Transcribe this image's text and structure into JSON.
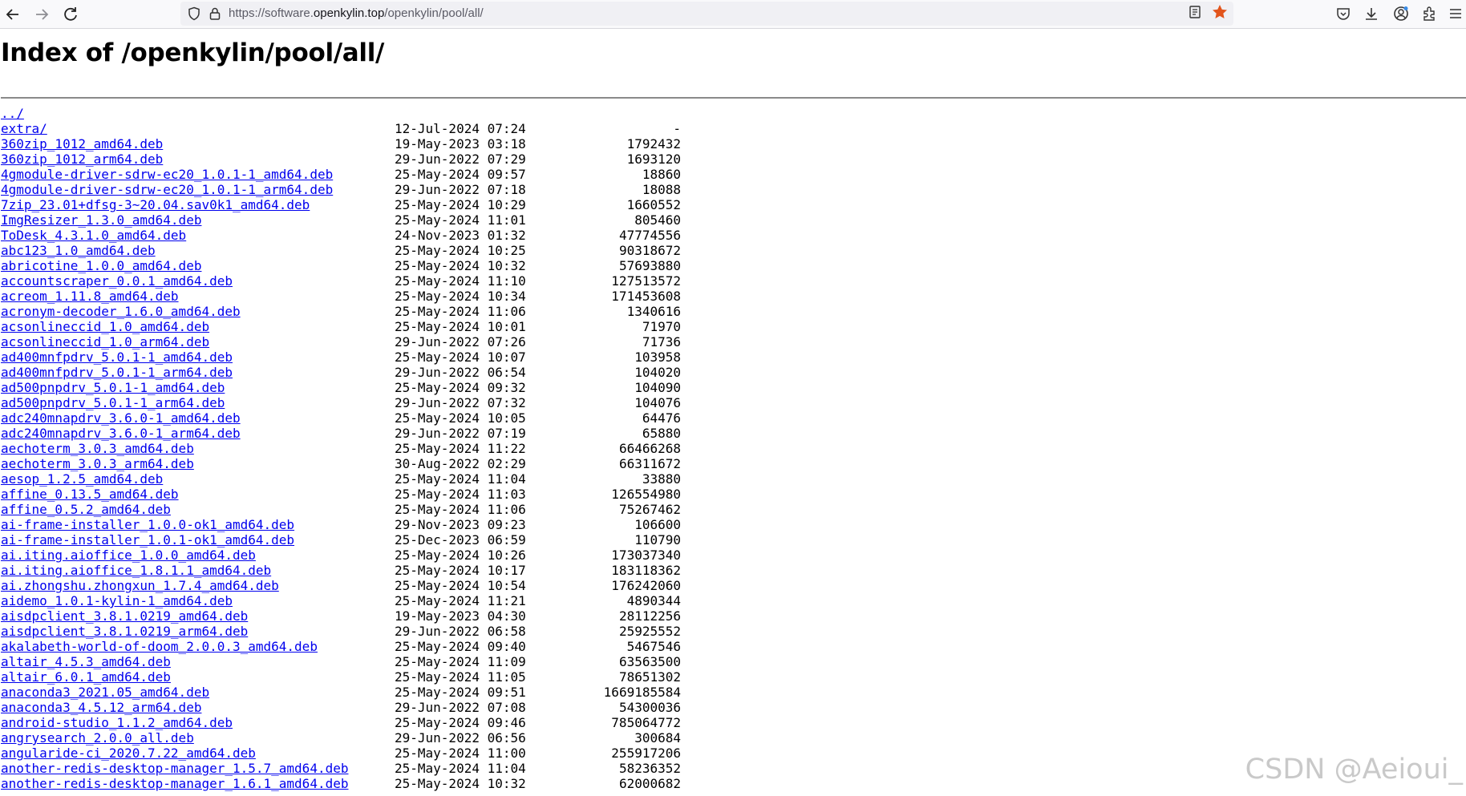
{
  "browser": {
    "url_prefix": "https://software.",
    "url_host": "openkylin.top",
    "url_path": "/openkylin/pool/all/",
    "icons": [
      "back-arrow-icon",
      "forward-arrow-icon",
      "reload-icon",
      "shield-icon",
      "lock-icon",
      "reader-view-icon",
      "bookmark-star-icon",
      "pocket-icon",
      "download-icon",
      "account-icon",
      "extensions-icon",
      "menu-icon"
    ],
    "star_color": "#e2541b"
  },
  "page": {
    "title": "Index of /openkylin/pool/all/",
    "watermark": "CSDN @Aeioui_",
    "link_color": "#0000ee"
  },
  "entries": [
    {
      "name": "../",
      "date": "",
      "size": ""
    },
    {
      "name": "extra/",
      "date": "12-Jul-2024 07:24",
      "size": "-"
    },
    {
      "name": "360zip_1012_amd64.deb",
      "date": "19-May-2023 03:18",
      "size": "1792432"
    },
    {
      "name": "360zip_1012_arm64.deb",
      "date": "29-Jun-2022 07:29",
      "size": "1693120"
    },
    {
      "name": "4gmodule-driver-sdrw-ec20_1.0.1-1_amd64.deb",
      "date": "25-May-2024 09:57",
      "size": "18860"
    },
    {
      "name": "4gmodule-driver-sdrw-ec20_1.0.1-1_arm64.deb",
      "date": "29-Jun-2022 07:18",
      "size": "18088"
    },
    {
      "name": "7zip_23.01+dfsg-3~20.04.sav0k1_amd64.deb",
      "date": "25-May-2024 10:29",
      "size": "1660552"
    },
    {
      "name": "ImgResizer_1.3.0_amd64.deb",
      "date": "25-May-2024 11:01",
      "size": "805460"
    },
    {
      "name": "ToDesk_4.3.1.0_amd64.deb",
      "date": "24-Nov-2023 01:32",
      "size": "47774556"
    },
    {
      "name": "abc123_1.0_amd64.deb",
      "date": "25-May-2024 10:25",
      "size": "90318672"
    },
    {
      "name": "abricotine_1.0.0_amd64.deb",
      "date": "25-May-2024 10:32",
      "size": "57693880"
    },
    {
      "name": "accountscraper_0.0.1_amd64.deb",
      "date": "25-May-2024 11:10",
      "size": "127513572"
    },
    {
      "name": "acreom_1.11.8_amd64.deb",
      "date": "25-May-2024 10:34",
      "size": "171453608"
    },
    {
      "name": "acronym-decoder_1.6.0_amd64.deb",
      "date": "25-May-2024 11:06",
      "size": "1340616"
    },
    {
      "name": "acsonlineccid_1.0_amd64.deb",
      "date": "25-May-2024 10:01",
      "size": "71970"
    },
    {
      "name": "acsonlineccid_1.0_arm64.deb",
      "date": "29-Jun-2022 07:26",
      "size": "71736"
    },
    {
      "name": "ad400mnfpdrv_5.0.1-1_amd64.deb",
      "date": "25-May-2024 10:07",
      "size": "103958"
    },
    {
      "name": "ad400mnfpdrv_5.0.1-1_arm64.deb",
      "date": "29-Jun-2022 06:54",
      "size": "104020"
    },
    {
      "name": "ad500pnpdrv_5.0.1-1_amd64.deb",
      "date": "25-May-2024 09:32",
      "size": "104090"
    },
    {
      "name": "ad500pnpdrv_5.0.1-1_arm64.deb",
      "date": "29-Jun-2022 07:32",
      "size": "104076"
    },
    {
      "name": "adc240mnapdrv_3.6.0-1_amd64.deb",
      "date": "25-May-2024 10:05",
      "size": "64476"
    },
    {
      "name": "adc240mnapdrv_3.6.0-1_arm64.deb",
      "date": "29-Jun-2022 07:19",
      "size": "65880"
    },
    {
      "name": "aechoterm_3.0.3_amd64.deb",
      "date": "25-May-2024 11:22",
      "size": "66466268"
    },
    {
      "name": "aechoterm_3.0.3_arm64.deb",
      "date": "30-Aug-2022 02:29",
      "size": "66311672"
    },
    {
      "name": "aesop_1.2.5_amd64.deb",
      "date": "25-May-2024 11:04",
      "size": "33880"
    },
    {
      "name": "affine_0.13.5_amd64.deb",
      "date": "25-May-2024 11:03",
      "size": "126554980"
    },
    {
      "name": "affine_0.5.2_amd64.deb",
      "date": "25-May-2024 11:06",
      "size": "75267462"
    },
    {
      "name": "ai-frame-installer_1.0.0-ok1_amd64.deb",
      "date": "29-Nov-2023 09:23",
      "size": "106600"
    },
    {
      "name": "ai-frame-installer_1.0.1-ok1_amd64.deb",
      "date": "25-Dec-2023 06:59",
      "size": "110790"
    },
    {
      "name": "ai.iting.aioffice_1.0.0_amd64.deb",
      "date": "25-May-2024 10:26",
      "size": "173037340"
    },
    {
      "name": "ai.iting.aioffice_1.8.1.1_amd64.deb",
      "date": "25-May-2024 10:17",
      "size": "183118362"
    },
    {
      "name": "ai.zhongshu.zhongxun_1.7.4_amd64.deb",
      "date": "25-May-2024 10:54",
      "size": "176242060"
    },
    {
      "name": "aidemo_1.0.1-kylin-1_amd64.deb",
      "date": "25-May-2024 11:21",
      "size": "4890344"
    },
    {
      "name": "aisdpclient_3.8.1.0219_amd64.deb",
      "date": "19-May-2023 04:30",
      "size": "28112256"
    },
    {
      "name": "aisdpclient_3.8.1.0219_arm64.deb",
      "date": "29-Jun-2022 06:58",
      "size": "25925552"
    },
    {
      "name": "akalabeth-world-of-doom_2.0.0.3_amd64.deb",
      "date": "25-May-2024 09:40",
      "size": "5467546"
    },
    {
      "name": "altair_4.5.3_amd64.deb",
      "date": "25-May-2024 11:09",
      "size": "63563500"
    },
    {
      "name": "altair_6.0.1_amd64.deb",
      "date": "25-May-2024 11:05",
      "size": "78651302"
    },
    {
      "name": "anaconda3_2021.05_amd64.deb",
      "date": "25-May-2024 09:51",
      "size": "1669185584"
    },
    {
      "name": "anaconda3_4.5.12_arm64.deb",
      "date": "29-Jun-2022 07:08",
      "size": "54300036"
    },
    {
      "name": "android-studio_1.1.2_amd64.deb",
      "date": "25-May-2024 09:46",
      "size": "785064772"
    },
    {
      "name": "angrysearch_2.0.0_all.deb",
      "date": "29-Jun-2022 06:56",
      "size": "300684"
    },
    {
      "name": "angularide-ci_2020.7.22_amd64.deb",
      "date": "25-May-2024 11:00",
      "size": "255917206"
    },
    {
      "name": "another-redis-desktop-manager_1.5.7_amd64.deb",
      "date": "25-May-2024 11:04",
      "size": "58236352"
    },
    {
      "name": "another-redis-desktop-manager_1.6.1_amd64.deb",
      "date": "25-May-2024 10:32",
      "size": "62000682"
    }
  ]
}
